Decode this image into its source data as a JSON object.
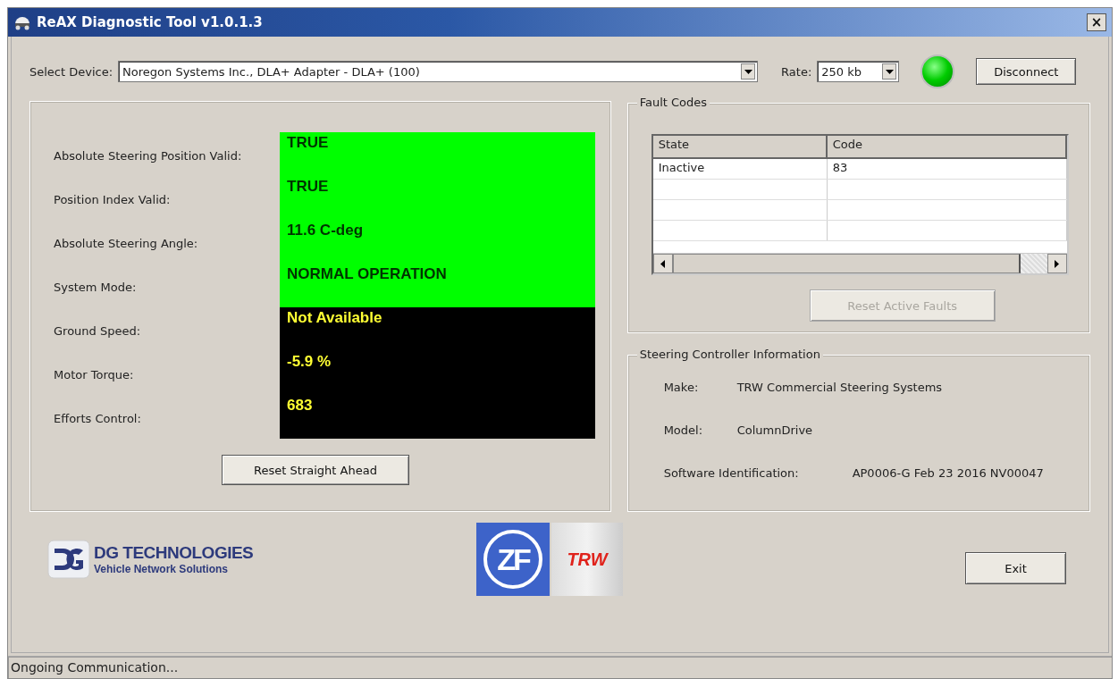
{
  "window": {
    "title": "ReAX Diagnostic Tool v1.0.1.3",
    "close": "×"
  },
  "device": {
    "label": "Select Device:",
    "value": "Noregon Systems Inc., DLA+ Adapter - DLA+ (100)",
    "rate_label": "Rate:",
    "rate": "250 kb",
    "connected": true,
    "disconnect": "Disconnect"
  },
  "parameters": [
    {
      "label": "Absolute Steering Position Valid:",
      "value": "TRUE",
      "color": "#00ff00"
    },
    {
      "label": "Position Index Valid:",
      "value": "TRUE",
      "color": "#00ff00"
    },
    {
      "label": "Absolute Steering Angle:",
      "value": "11.6 C-deg",
      "color": "#00ff00"
    },
    {
      "label": "System Mode:",
      "value": "NORMAL OPERATION",
      "color": "#00ff00"
    },
    {
      "label": "Ground Speed:",
      "value": "Not Available",
      "color": "#000000"
    },
    {
      "label": "Motor Torque:",
      "value": "-5.9 %",
      "color": "#000000"
    },
    {
      "label": "Efforts Control:",
      "value": "683",
      "color": "#000000"
    }
  ],
  "reset_straight_ahead": "Reset Straight Ahead",
  "fault_codes": {
    "title": "Fault Codes",
    "columns": [
      "State",
      "Code"
    ],
    "rows": [
      [
        "Inactive",
        "83"
      ]
    ],
    "reset_button": {
      "label": "Reset Active Faults",
      "disabled": true
    }
  },
  "controller_info": {
    "title": "Steering Controller Information",
    "fields": [
      {
        "label": "Make:",
        "value": "TRW Commercial Steering Systems"
      },
      {
        "label": "Model:",
        "value": "ColumnDrive"
      },
      {
        "label": "Software Identification:",
        "value": "AP0006-G Feb 23 2016 NV00047"
      }
    ]
  },
  "logos": {
    "dg_name": "DG TECHNOLOGIES",
    "dg_tagline": "Vehicle Network Solutions",
    "zf": "ZF",
    "trw": "TRW"
  },
  "exit": "Exit",
  "status_bar": "Ongoing Communication..."
}
